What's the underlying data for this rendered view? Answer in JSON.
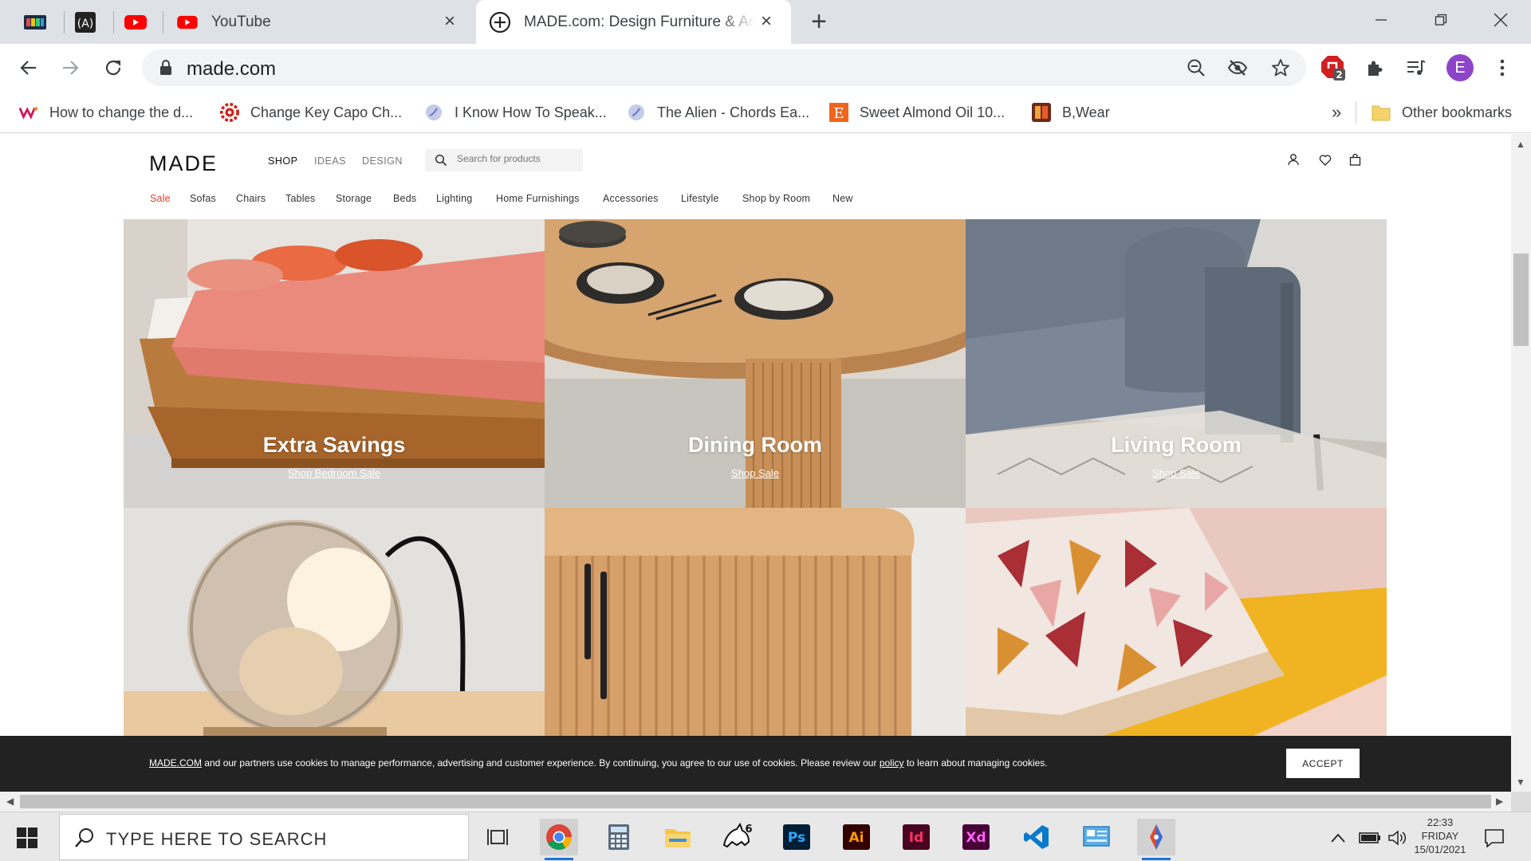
{
  "browser": {
    "tabs": [
      {
        "title": "YouTube",
        "active": false
      },
      {
        "title": "MADE.com: Design Furniture & Accessories",
        "active": true
      }
    ],
    "close_glyph": "×",
    "new_tab_glyph": "+",
    "url": "made.com",
    "profile_initial": "E",
    "extension_badge": "2",
    "bookmarks": [
      {
        "label": "How to change the d..."
      },
      {
        "label": "Change Key Capo Ch..."
      },
      {
        "label": "I Know How To Speak..."
      },
      {
        "label": "The Alien - Chords Ea..."
      },
      {
        "label": "Sweet Almond Oil 10..."
      },
      {
        "label": "B,Wear"
      }
    ],
    "bookmarks_overflow": "»",
    "other_bookmarks": "Other bookmarks"
  },
  "site": {
    "logo": "MADE",
    "top_nav": [
      "SHOP",
      "IDEAS",
      "DESIGN"
    ],
    "search_placeholder": "Search for products",
    "categories": [
      "Sale",
      "Sofas",
      "Chairs",
      "Tables",
      "Storage",
      "Beds",
      "Lighting",
      "Home Furnishings",
      "Accessories",
      "Lifestyle",
      "Shop by Room",
      "New"
    ],
    "tiles": [
      {
        "title": "Extra Savings",
        "link": "Shop Bedroom Sale"
      },
      {
        "title": "Dining Room",
        "link": "Shop Sale"
      },
      {
        "title": "Living Room",
        "link": "Shop Sale"
      },
      {
        "title": "",
        "link": ""
      },
      {
        "title": "",
        "link": ""
      },
      {
        "title": "",
        "link": ""
      }
    ],
    "cookie": {
      "brand": "MADE.COM",
      "text_a": " and our partners use cookies to manage performance, advertising and customer experience. By continuing, you agree to our use of cookies. Please review our ",
      "policy": "policy",
      "text_b": " to learn about managing cookies.",
      "accept": "ACCEPT"
    }
  },
  "taskbar": {
    "search_placeholder": "TYPE HERE TO SEARCH",
    "rhino_badge": "6",
    "ps_label": "Ps",
    "ai_label": "Ai",
    "id_label": "Id",
    "xd_label": "Xd",
    "time": "22:33",
    "day": "FRIDAY",
    "date": "15/01/2021"
  },
  "colors": {
    "sale_red": "#e0412f",
    "cookie_bg": "#222222",
    "tab_strip": "#dee1e6",
    "profile_purple": "#8e44c9"
  }
}
